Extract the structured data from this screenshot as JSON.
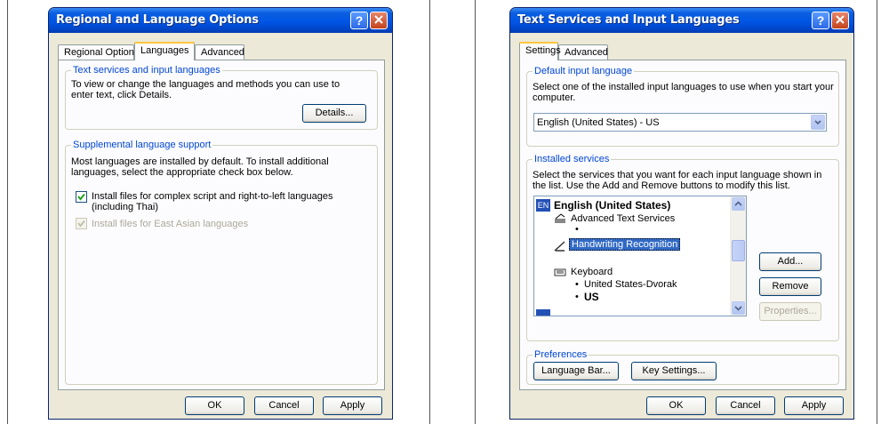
{
  "regional": {
    "title": "Regional and Language Options",
    "tabs": [
      "Regional Options",
      "Languages",
      "Advanced"
    ],
    "group1": {
      "title": "Text services and input languages",
      "text": "To view or change the languages and methods you can use to enter text, click Details.",
      "details_button": "Details..."
    },
    "group2": {
      "title": "Supplemental language support",
      "text": "Most languages are installed by default. To install additional languages, select the appropriate check box below.",
      "check1": "Install files for complex script and right-to-left languages (including Thai)",
      "check2": "Install files for East Asian languages"
    },
    "buttons": {
      "ok": "OK",
      "cancel": "Cancel",
      "apply": "Apply"
    }
  },
  "textservices": {
    "title": "Text Services and Input Languages",
    "tabs": [
      "Settings",
      "Advanced"
    ],
    "default_group": {
      "title": "Default input language",
      "text": "Select one of the installed input languages to use when you start your computer.",
      "selected": "English (United States) - US"
    },
    "installed_group": {
      "title": "Installed services",
      "text": "Select the services that you want for each input language shown in the list. Use the Add and Remove buttons to modify this list.",
      "lang_badge": "EN",
      "language": "English (United States)",
      "items": {
        "advanced": "Advanced Text Services",
        "handwriting": "Handwriting Recognition",
        "keyboard": "Keyboard",
        "dvorak": "United States-Dvorak",
        "us": "US"
      },
      "add": "Add...",
      "remove": "Remove",
      "properties": "Properties..."
    },
    "prefs_group": {
      "title": "Preferences",
      "language_bar": "Language Bar...",
      "key_settings": "Key Settings..."
    },
    "buttons": {
      "ok": "OK",
      "cancel": "Cancel",
      "apply": "Apply"
    }
  }
}
